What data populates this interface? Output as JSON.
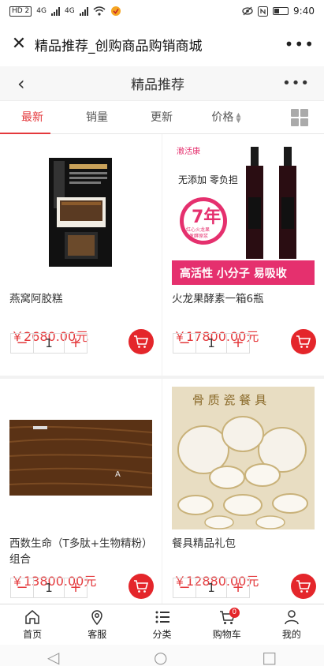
{
  "status_bar": {
    "left_tag": "HD 2",
    "network_1": "4G",
    "network_2": "4G",
    "time": "9:40"
  },
  "webview": {
    "title": "精品推荐_创购商品购销商城",
    "close_icon": "close-icon",
    "more_icon": "more-icon"
  },
  "header": {
    "title": "精品推荐",
    "back_icon": "chevron-left-icon",
    "more_icon": "more-icon"
  },
  "sort_tabs": [
    {
      "label": "最新"
    },
    {
      "label": "销量"
    },
    {
      "label": "更新"
    },
    {
      "label": "价格"
    }
  ],
  "products": [
    {
      "name": "燕窝阿胶糕",
      "price": "￥2680.00元",
      "qty": "1",
      "image": "bird-nest-product-photo"
    },
    {
      "name": "火龙果酵素一箱6瓶",
      "price": "￥17800.00元",
      "qty": "1",
      "image": "wine-bottles-product-photo",
      "ad": {
        "brand": "澈活康",
        "line1": "无添加  零负担",
        "badge_big": "7年",
        "badge_small1": "红心火龙果",
        "badge_small2": "发酵原浆",
        "bottom": "高活性 小分子 易吸收"
      }
    },
    {
      "name": "西数生命（T多肽+生物精粉）组合",
      "price": "￥13800.00元",
      "qty": "1",
      "image": "wooden-box-product-photo"
    },
    {
      "name": "餐具精品礼包",
      "price": "￥12880.00元",
      "qty": "1",
      "image": "porcelain-tableware-product-photo",
      "ad": {
        "top": "骨 质 瓷 餐 具"
      }
    }
  ],
  "tabbar": [
    {
      "label": "首页",
      "icon": "home-icon"
    },
    {
      "label": "客服",
      "icon": "location-pin-icon"
    },
    {
      "label": "分类",
      "icon": "list-icon"
    },
    {
      "label": "购物车",
      "icon": "cart-icon",
      "badge": "0"
    },
    {
      "label": "我的",
      "icon": "user-icon"
    }
  ],
  "colors": {
    "accent": "#e4393c",
    "cart_button": "#e4262b"
  }
}
